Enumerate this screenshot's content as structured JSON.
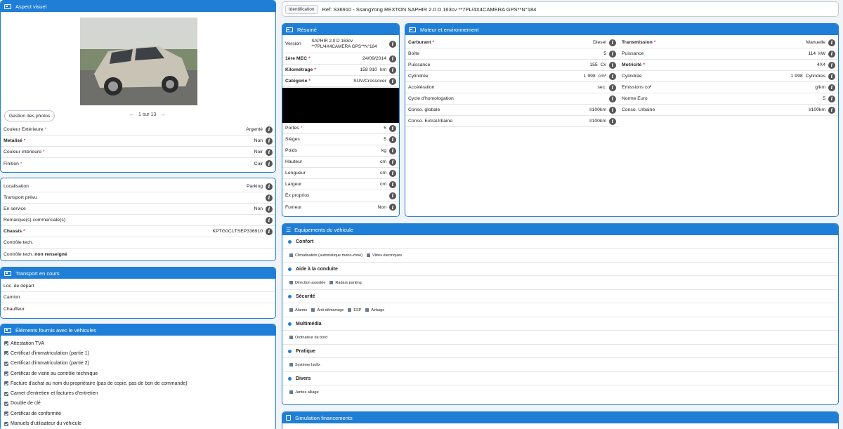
{
  "visual": {
    "title": "Aspect visuel",
    "manage_photos": "Gestion des photos",
    "pager": "1 sur 13",
    "rows": [
      {
        "label": "Couleur Extérieure",
        "req": "*",
        "value": "Argenté"
      },
      {
        "label": "Metalisé",
        "req": "*",
        "value": "Non"
      },
      {
        "label": "Couleur intérieure",
        "req": "*",
        "value": "Noir"
      },
      {
        "label": "Finition",
        "req": "*",
        "value": "Cuir"
      }
    ]
  },
  "location": {
    "rows": [
      {
        "label": "Localisation",
        "value": "Parking"
      },
      {
        "label": "Transport prévu",
        "value": ""
      },
      {
        "label": "En service",
        "value": "Non"
      },
      {
        "label": "Remarque(s) commerciale(s)",
        "value": ""
      },
      {
        "label": "Chassis",
        "req": "*",
        "value": "KPTG0C1TSEP336910"
      },
      {
        "label": "Contrôle tech.",
        "value": ""
      }
    ],
    "ct_prefix": "Contrôle tech.",
    "ct_status": "non renseigné"
  },
  "transport": {
    "title": "Transport en cours",
    "rows": [
      "Loc. de départ",
      "Camion",
      "Chauffeur"
    ]
  },
  "elements": {
    "title": "Éléments fournis avec le véhicules",
    "items": [
      "Attestation TVA",
      "Certificat d'immatriculation (partie 1)",
      "Certificat d'immatriculation (partie 2)",
      "Certificat de visite au contrôle technique",
      "Facture d'achat au nom du propriétaire (pas de copie, pas de bon de commande)",
      "Carnet d'entretien et factures d'entretien",
      "Double de clé",
      "Certificat de conformité",
      "Manuels d'utilisateur du véhicule"
    ]
  },
  "identification": {
    "label": "Identification",
    "ref": "Ref: S36910 - SsangYong REXTON SAPHIR 2.0 D 163cv **7PL/4X4CAMERA GPS**N°184"
  },
  "resume": {
    "title": "Résumé",
    "version_label": "Version",
    "version_value": "SAPHIR 2.0 D 163cv **7PL/4X4CAMERA GPS**N°184",
    "rows_top": [
      {
        "label": "1ère MEC",
        "req": "*",
        "value": "24/09/2014",
        "unit": ""
      },
      {
        "label": "Kilométrage",
        "req": "*",
        "value": "158 910",
        "unit": "km"
      },
      {
        "label": "Catégorie",
        "req": "*",
        "value": "SUV/Crossover",
        "unit": ""
      }
    ],
    "rows_bottom": [
      {
        "label": "Portes",
        "req": "*",
        "value": "5",
        "unit": ""
      },
      {
        "label": "Sièges",
        "value": "5",
        "unit": ""
      },
      {
        "label": "Poids",
        "value": "",
        "unit": "kg"
      },
      {
        "label": "Hauteur",
        "value": "",
        "unit": "cm"
      },
      {
        "label": "Longueur",
        "value": "",
        "unit": "cm"
      },
      {
        "label": "Largeur",
        "value": "",
        "unit": "cm"
      },
      {
        "label": "Ex proprios",
        "value": "",
        "unit": ""
      },
      {
        "label": "Fumeur",
        "value": "Non",
        "unit": ""
      }
    ]
  },
  "motor": {
    "title": "Moteur et environnement",
    "left": [
      {
        "label": "Carburant",
        "req": "*",
        "value": "Diesel",
        "unit": ""
      },
      {
        "label": "Boîte",
        "value": "5",
        "unit": ""
      },
      {
        "label": "Puissance",
        "value": "155",
        "unit": "Cv"
      },
      {
        "label": "Cylindrée",
        "value": "1 998",
        "unit": "cm³"
      },
      {
        "label": "Accélération",
        "value": "",
        "unit": "sec."
      },
      {
        "label": "Cycle d'homologation",
        "value": "",
        "unit": ""
      },
      {
        "label": "Conso. globale",
        "value": "",
        "unit": "l/100km"
      },
      {
        "label": "Conso. ExtraUrbaine",
        "value": "",
        "unit": "l/100km"
      }
    ],
    "right": [
      {
        "label": "Transmission",
        "req": "*",
        "value": "Manuelle",
        "unit": ""
      },
      {
        "label": "Puissance",
        "value": "114",
        "unit": "kW"
      },
      {
        "label": "Motricité",
        "req": "*",
        "value": "4X4",
        "unit": ""
      },
      {
        "label": "Cylindrée",
        "value": "1 998",
        "unit": "Cylindres"
      },
      {
        "label": "Émissions co²",
        "value": "",
        "unit": "g/km"
      },
      {
        "label": "Norme Euro",
        "value": "5",
        "unit": ""
      },
      {
        "label": "Conso. Urbaine",
        "value": "",
        "unit": "l/100km"
      }
    ]
  },
  "equipements": {
    "title": "Equipements du véhicule",
    "groups": [
      {
        "name": "Confort",
        "items": [
          "Climatisation (automatique mono-zone)",
          "Vitres électriques"
        ]
      },
      {
        "name": "Aide à la conduite",
        "items": [
          "Direction assistée",
          "Radars parking"
        ]
      },
      {
        "name": "Sécurité",
        "items": [
          "Alarme",
          "Anti-démarrage",
          "ESP",
          "Airbags"
        ]
      },
      {
        "name": "Multimédia",
        "items": [
          "Ordinateur de bord"
        ]
      },
      {
        "name": "Pratique",
        "items": [
          "Système Isofix"
        ]
      },
      {
        "name": "Divers",
        "items": [
          "Jantes alliage"
        ]
      }
    ]
  },
  "financement": {
    "title": "Simulation financements"
  },
  "colors": {
    "accent": "#1f7fd6",
    "required": "#e03030",
    "info": "#555555"
  }
}
